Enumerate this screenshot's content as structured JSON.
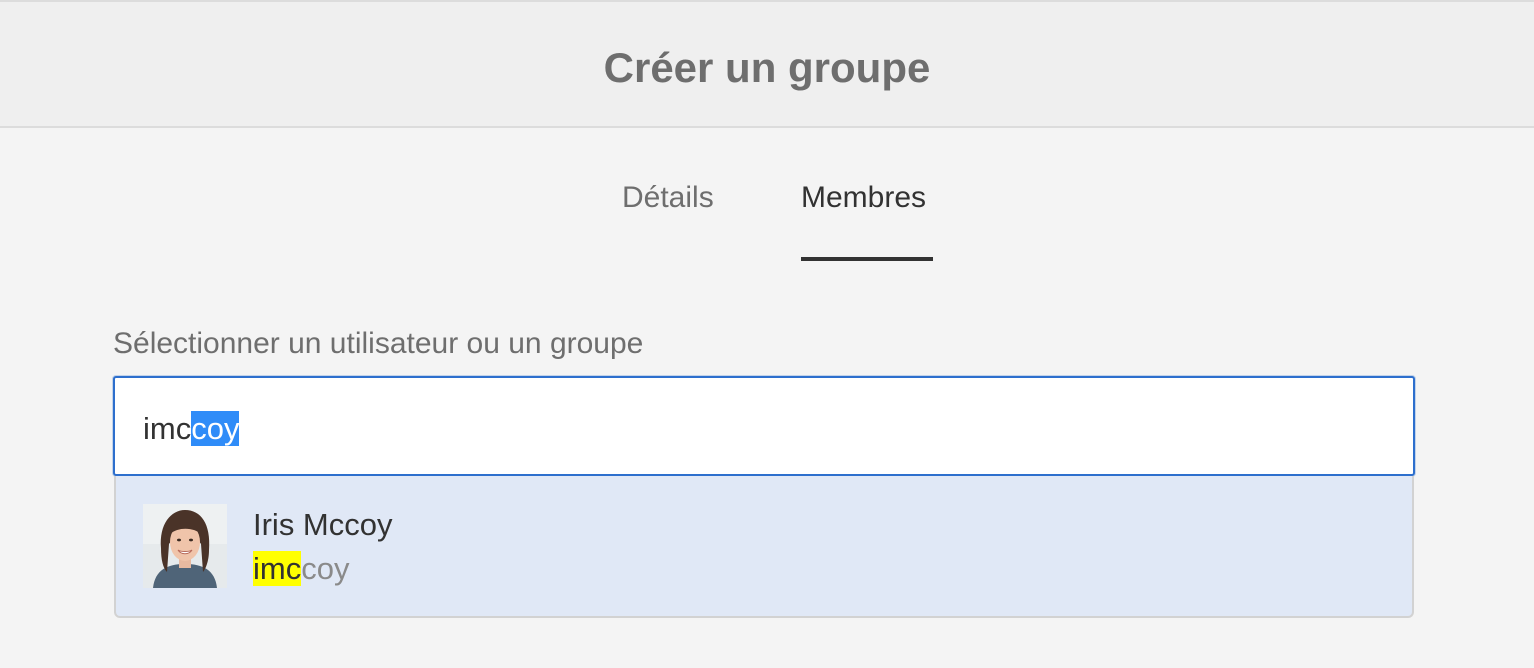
{
  "dialog": {
    "title": "Créer un groupe"
  },
  "tabs": [
    {
      "label": "Détails",
      "active": false
    },
    {
      "label": "Membres",
      "active": true
    }
  ],
  "member_picker": {
    "label": "Sélectionner un utilisateur ou un groupe",
    "input_typed": "imc",
    "input_autocomplete": "coy"
  },
  "suggestions": [
    {
      "name": "Iris Mccoy",
      "id_match": "imc",
      "id_rest": "coy",
      "avatar": "user-avatar-photo"
    }
  ],
  "colors": {
    "accent": "#2d6fcd",
    "selection": "#2f8cf8",
    "match_highlight": "#ffff00",
    "suggestion_bg": "#e0e8f6"
  }
}
